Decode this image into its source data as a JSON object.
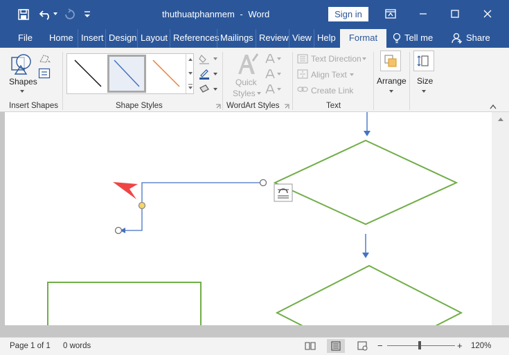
{
  "titlebar": {
    "doc_title": "thuthuatphanmem",
    "separator": "-",
    "app_name": "Word",
    "sign_in": "Sign in"
  },
  "tabs": [
    "File",
    "Home",
    "Insert",
    "Design",
    "Layout",
    "References",
    "Mailings",
    "Review",
    "View",
    "Help",
    "Format"
  ],
  "tell_me": "Tell me",
  "share": "Share",
  "ribbon": {
    "shapes_label": "Shapes",
    "insert_shapes_group": "Insert Shapes",
    "shape_styles_group": "Shape Styles",
    "quick_styles_line1": "Quick",
    "quick_styles_line2": "Styles",
    "wordart_group": "WordArt Styles",
    "text_direction": "Text Direction",
    "align_text": "Align Text",
    "create_link": "Create Link",
    "text_group": "Text",
    "arrange": "Arrange",
    "size": "Size"
  },
  "status": {
    "page": "Page 1 of 1",
    "words": "0 words",
    "zoom_minus": "−",
    "zoom_plus": "+",
    "zoom": "120%"
  },
  "zoom_level_fraction": 0.48,
  "colors": {
    "brand": "#2b579a",
    "shape_outline": "#70ad47",
    "connector": "#4472c4",
    "pointer": "#ef4545"
  }
}
